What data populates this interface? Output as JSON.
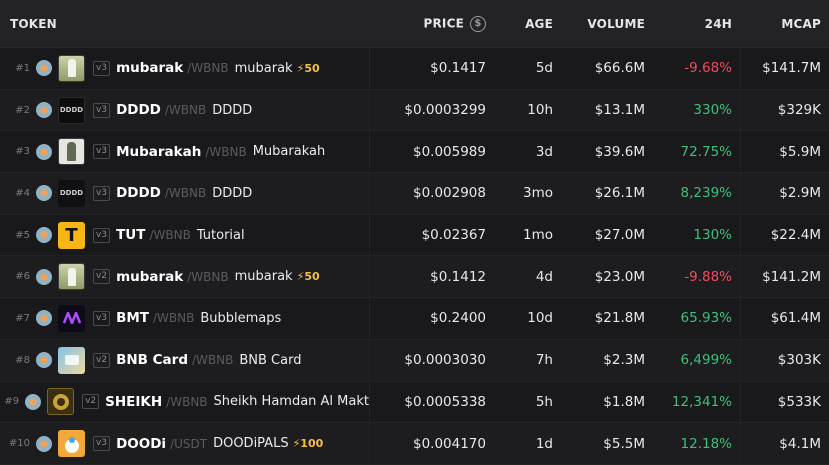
{
  "header": {
    "token": "TOKEN",
    "price": "PRICE",
    "price_icon": "$",
    "age": "AGE",
    "volume": "VOLUME",
    "change": "24H",
    "mcap": "MCAP"
  },
  "rows": [
    {
      "rank": "#1",
      "ver": "v3",
      "symbol": "mubarak",
      "pair": "/WBNB",
      "name": "mubarak",
      "boost": "⚡50",
      "price": "$0.1417",
      "age": "5d",
      "volume": "$66.6M",
      "change": "-9.68%",
      "change_sign": "neg",
      "mcap": "$141.7M",
      "thumb_text": ""
    },
    {
      "rank": "#2",
      "ver": "v3",
      "symbol": "DDDD",
      "pair": "/WBNB",
      "name": "DDDD",
      "boost": "",
      "price": "$0.0003299",
      "age": "10h",
      "volume": "$13.1M",
      "change": "330%",
      "change_sign": "pos",
      "mcap": "$329K",
      "thumb_text": "DDDD"
    },
    {
      "rank": "#3",
      "ver": "v3",
      "symbol": "Mubarakah",
      "pair": "/WBNB",
      "name": "Mubarakah",
      "boost": "",
      "price": "$0.005989",
      "age": "3d",
      "volume": "$39.6M",
      "change": "72.75%",
      "change_sign": "pos",
      "mcap": "$5.9M",
      "thumb_text": ""
    },
    {
      "rank": "#4",
      "ver": "v3",
      "symbol": "DDDD",
      "pair": "/WBNB",
      "name": "DDDD",
      "boost": "",
      "price": "$0.002908",
      "age": "3mo",
      "volume": "$26.1M",
      "change": "8,239%",
      "change_sign": "pos",
      "mcap": "$2.9M",
      "thumb_text": "DDDD"
    },
    {
      "rank": "#5",
      "ver": "v3",
      "symbol": "TUT",
      "pair": "/WBNB",
      "name": "Tutorial",
      "boost": "",
      "price": "$0.02367",
      "age": "1mo",
      "volume": "$27.0M",
      "change": "130%",
      "change_sign": "pos",
      "mcap": "$22.4M",
      "thumb_text": "T"
    },
    {
      "rank": "#6",
      "ver": "v2",
      "symbol": "mubarak",
      "pair": "/WBNB",
      "name": "mubarak",
      "boost": "⚡50",
      "price": "$0.1412",
      "age": "4d",
      "volume": "$23.0M",
      "change": "-9.88%",
      "change_sign": "neg",
      "mcap": "$141.2M",
      "thumb_text": ""
    },
    {
      "rank": "#7",
      "ver": "v3",
      "symbol": "BMT",
      "pair": "/WBNB",
      "name": "Bubblemaps",
      "boost": "",
      "price": "$0.2400",
      "age": "10d",
      "volume": "$21.8M",
      "change": "65.93%",
      "change_sign": "pos",
      "mcap": "$61.4M",
      "thumb_text": ""
    },
    {
      "rank": "#8",
      "ver": "v2",
      "symbol": "BNB Card",
      "pair": "/WBNB",
      "name": "BNB Card",
      "boost": "",
      "price": "$0.0003030",
      "age": "7h",
      "volume": "$2.3M",
      "change": "6,499%",
      "change_sign": "pos",
      "mcap": "$303K",
      "thumb_text": ""
    },
    {
      "rank": "#9",
      "ver": "v2",
      "symbol": "SHEIKH",
      "pair": "/WBNB",
      "name": "Sheikh Hamdan Al Makt",
      "boost": "",
      "price": "$0.0005338",
      "age": "5h",
      "volume": "$1.8M",
      "change": "12,341%",
      "change_sign": "pos",
      "mcap": "$533K",
      "thumb_text": ""
    },
    {
      "rank": "#10",
      "ver": "v3",
      "symbol": "DOODi",
      "pair": "/USDT",
      "name": "DOODiPALS",
      "boost": "⚡100",
      "price": "$0.004170",
      "age": "1d",
      "volume": "$5.5M",
      "change": "12.18%",
      "change_sign": "pos",
      "mcap": "$4.1M",
      "thumb_text": ""
    }
  ],
  "colors": {
    "positive": "#3fbf7a",
    "negative": "#ef4d5c",
    "boost": "#f2c14a"
  },
  "icons": {
    "chain": "bnb-chain-icon",
    "price_toggle": "dollar-circle-icon",
    "boost": "lightning-icon"
  }
}
